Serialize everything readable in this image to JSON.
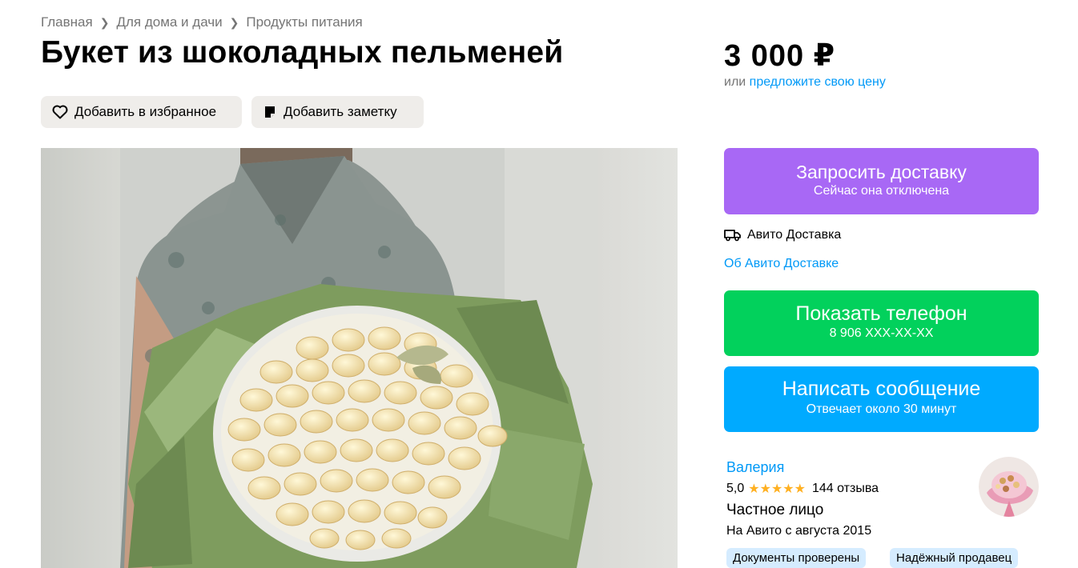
{
  "breadcrumb": [
    "Главная",
    "Для дома и дачи",
    "Продукты питания"
  ],
  "title": "Букет из шоколадных пельменей",
  "actions": {
    "favorite": "Добавить в избранное",
    "note": "Добавить заметку"
  },
  "price": {
    "value": "3 000 ₽",
    "offer_prefix": "или",
    "offer_link": "предложите свою цену"
  },
  "delivery": {
    "button_main": "Запросить доставку",
    "button_sub": "Сейчас она отключена",
    "service": "Авито Доставка",
    "about_link": "Об Авито Доставке"
  },
  "phone": {
    "button_main": "Показать телефон",
    "number": "8 906 XXX-XX-XX"
  },
  "message": {
    "button_main": "Написать сообщение",
    "button_sub": "Отвечает около 30 минут"
  },
  "seller": {
    "name": "Валерия",
    "rating": "5,0",
    "stars": "★★★★★",
    "reviews": "144 отзыва",
    "type": "Частное лицо",
    "since": "На Авито с августа 2015",
    "badges": [
      "Документы проверены",
      "Надёжный продавец"
    ]
  },
  "icons": {
    "favorite": "heart-icon",
    "note": "note-icon",
    "delivery": "truck-icon",
    "breadcrumb": "chevron-right-icon"
  },
  "colors": {
    "link": "#0099f7",
    "delivery": "#a868f5",
    "phone": "#02d15c",
    "message": "#00aaff",
    "badge": "#d5ecff",
    "stars": "#ffb021"
  }
}
